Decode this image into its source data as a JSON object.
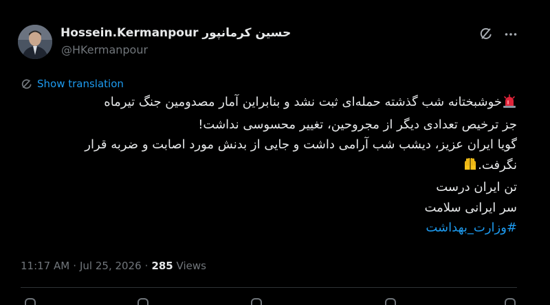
{
  "author": {
    "display_name": "Hossein.Kermanpour حسین کرمانپور",
    "handle": "@HKermanpour",
    "avatar": "avatar-photo"
  },
  "header_icons": [
    "grok-icon",
    "more-icon"
  ],
  "translation": {
    "label": "Show translation",
    "icon": "translate-icon"
  },
  "tweet": {
    "lines": [
      "خوشبختانه شب گذشته حمله‌ای ثبت نشد و بنابراین آمار مصدومین جنگ تیرماه",
      "جز ترخیص تعدادی دیگر از مجروحین، تغییر محسوسی نداشت!",
      "گویا ایران عزیز، دیشب شب آرامی داشت و جایی از بدنش مورد اصابت و ضربه قرار",
      "نگرفت.",
      "تن ایران درست",
      "سر ایرانی سلامت"
    ],
    "hashtag": "#وزارت_بهداشت",
    "emojis": [
      "siren-emoji",
      "raising-hands-emoji"
    ]
  },
  "meta": {
    "time": "11:17 AM",
    "separator": "·",
    "date": "Jul 25, 2026",
    "views_count": "285",
    "views_label": "Views"
  },
  "colors": {
    "background": "#000000",
    "text_primary": "#e7e9ea",
    "text_secondary": "#71767b",
    "accent": "#1d9bf0",
    "divider": "#2f3336"
  }
}
